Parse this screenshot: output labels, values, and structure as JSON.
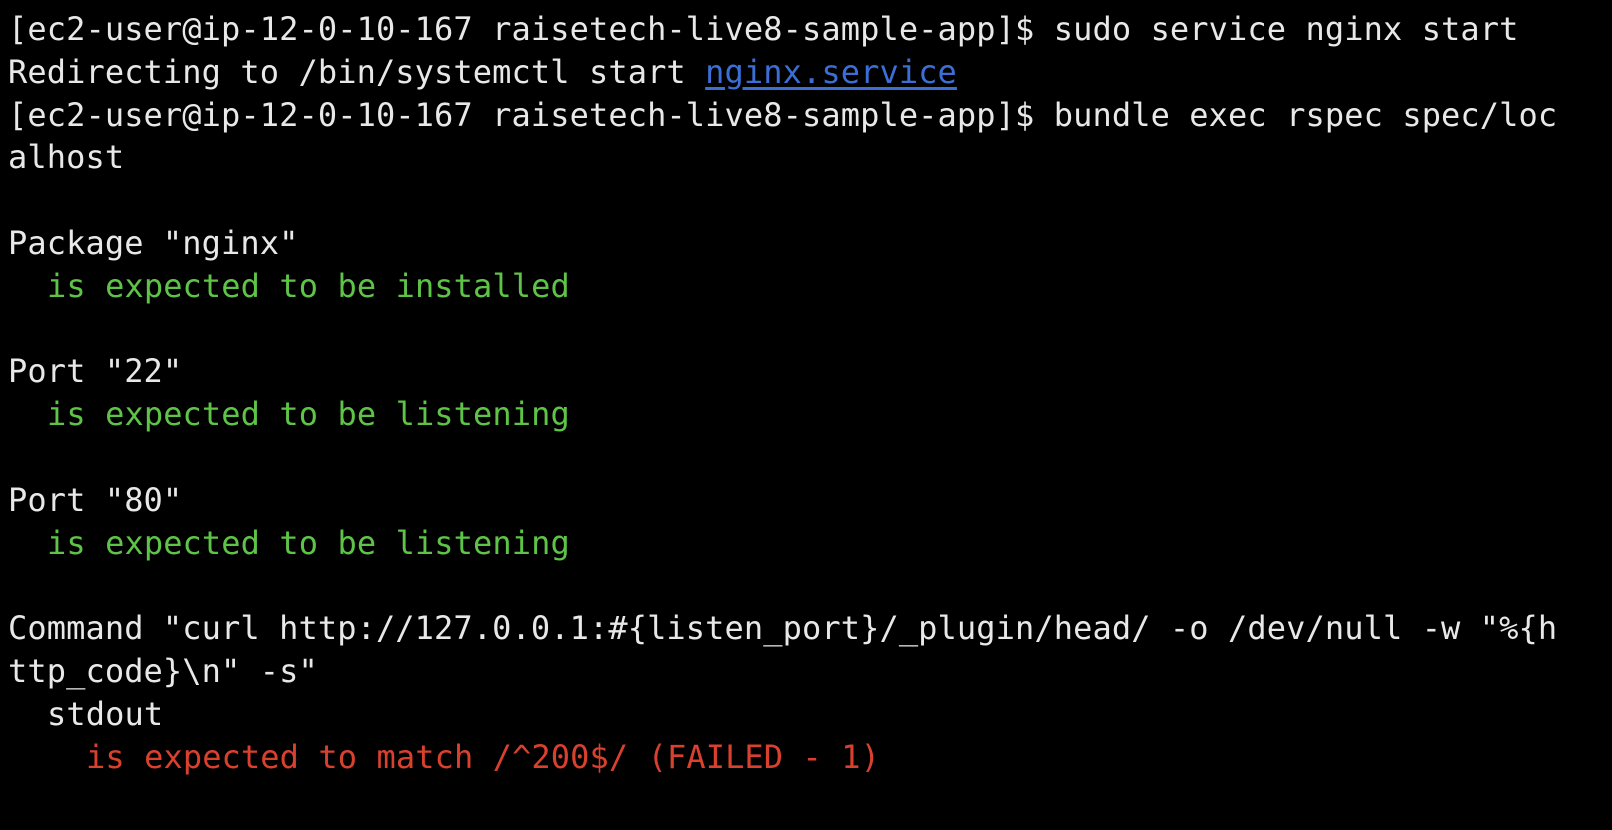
{
  "colors": {
    "background": "#000000",
    "foreground": "#e8e8e8",
    "pass": "#5ec447",
    "fail": "#d9412e",
    "link": "#3b6fd6"
  },
  "terminal": {
    "lines": {
      "l1_prompt": "[ec2-user@ip-12-0-10-167 raisetech-live8-sample-app]$ sudo service nginx start",
      "l2_prefix": "Redirecting to /bin/systemctl start ",
      "l2_link": "nginx.service",
      "l3": "[ec2-user@ip-12-0-10-167 raisetech-live8-sample-app]$ bundle exec rspec spec/loc",
      "l4": "alhost",
      "l6": "Package \"nginx\"",
      "l7": "is expected to be installed",
      "l9": "Port \"22\"",
      "l10": "is expected to be listening",
      "l12": "Port \"80\"",
      "l13": "is expected to be listening",
      "l15": "Command \"curl http://127.0.0.1:#{listen_port}/_plugin/head/ -o /dev/null -w \"%{h",
      "l16": "ttp_code}\\n\" -s\"",
      "l17": "stdout",
      "l18": "is expected to match /^200$/ (FAILED - 1)"
    }
  }
}
